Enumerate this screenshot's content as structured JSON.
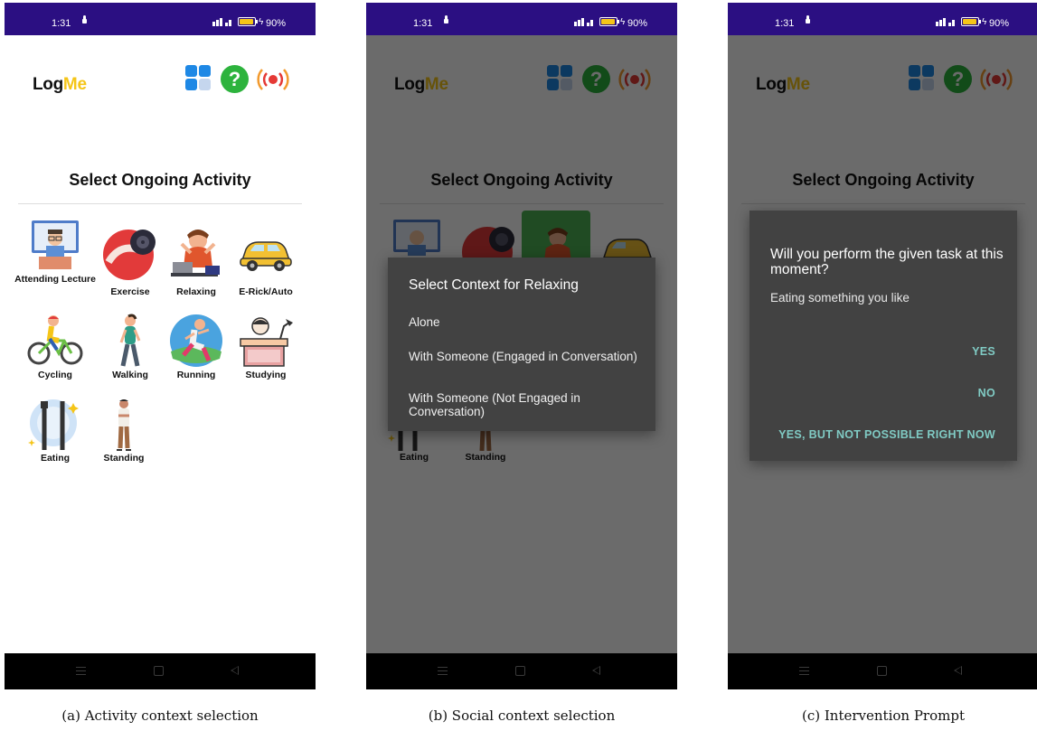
{
  "status_bar": {
    "time": "1:31",
    "battery": "90%",
    "bolt": "ϟ"
  },
  "app": {
    "name_part1": "Log",
    "name_part2": "Me"
  },
  "toolbar_icons": [
    "grid-icon",
    "help-icon",
    "broadcast-icon"
  ],
  "help_glyph": "?",
  "heading": "Select Ongoing Activity",
  "activities": [
    {
      "label": "Attending Lecture",
      "icon": "lecture-icon"
    },
    {
      "label": "Exercise",
      "icon": "dumbbell-icon"
    },
    {
      "label": "Relaxing",
      "icon": "relaxing-person-icon"
    },
    {
      "label": "E-Rick/Auto",
      "icon": "car-icon"
    },
    {
      "label": "Cycling",
      "icon": "cyclist-icon"
    },
    {
      "label": "Walking",
      "icon": "walking-person-icon"
    },
    {
      "label": "Running",
      "icon": "runner-icon"
    },
    {
      "label": "Studying",
      "icon": "studying-person-icon"
    },
    {
      "label": "Eating",
      "icon": "plate-icon"
    },
    {
      "label": "Standing",
      "icon": "standing-person-icon"
    }
  ],
  "social_dialog": {
    "title": "Select Context for Relaxing",
    "options": [
      "Alone",
      "With Someone (Engaged in Conversation)",
      "With Someone (Not Engaged in Conversation)"
    ]
  },
  "intervention_dialog": {
    "title": "Will you perform the given task at this moment?",
    "message": "Eating something you like",
    "actions": [
      "YES",
      "NO",
      "YES, BUT NOT POSSIBLE RIGHT NOW"
    ]
  },
  "captions": [
    "(a) Activity context selection",
    "(b) Social context selection",
    "(c) Intervention Prompt"
  ],
  "colors": {
    "status_bar": "#2b0f82",
    "logo_accent": "#f5c518",
    "help_green": "#2db33d",
    "broadcast_red": "#e53935",
    "grid_blue": "#1e88e5",
    "selected_tile": "#4db455",
    "dialog_bg": "#424242",
    "dialog_action": "#80cbc4"
  }
}
